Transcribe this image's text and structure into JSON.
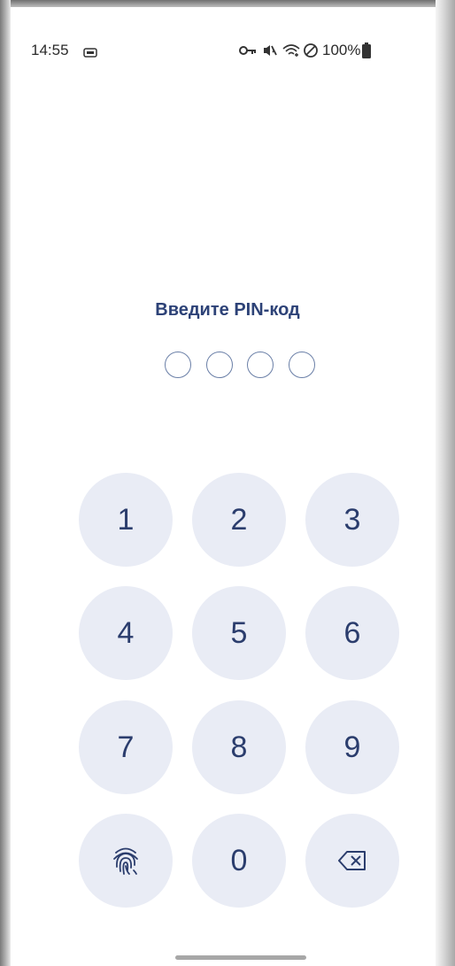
{
  "status_bar": {
    "time": "14:55",
    "battery": "100%",
    "icons": [
      "screen-record-icon",
      "vpn-key-icon",
      "mute-icon",
      "wifi-icon",
      "do-not-disturb-icon",
      "battery-icon"
    ]
  },
  "pin": {
    "title": "Введите PIN-код",
    "length": 4,
    "entered": 0
  },
  "keypad": {
    "keys": [
      "1",
      "2",
      "3",
      "4",
      "5",
      "6",
      "7",
      "8",
      "9",
      "0"
    ],
    "fingerprint_icon": "fingerprint-icon",
    "backspace_icon": "backspace-icon"
  },
  "colors": {
    "accent": "#2d4277",
    "key_background": "#e9ecf5",
    "dot_border": "#6a7fa7"
  }
}
